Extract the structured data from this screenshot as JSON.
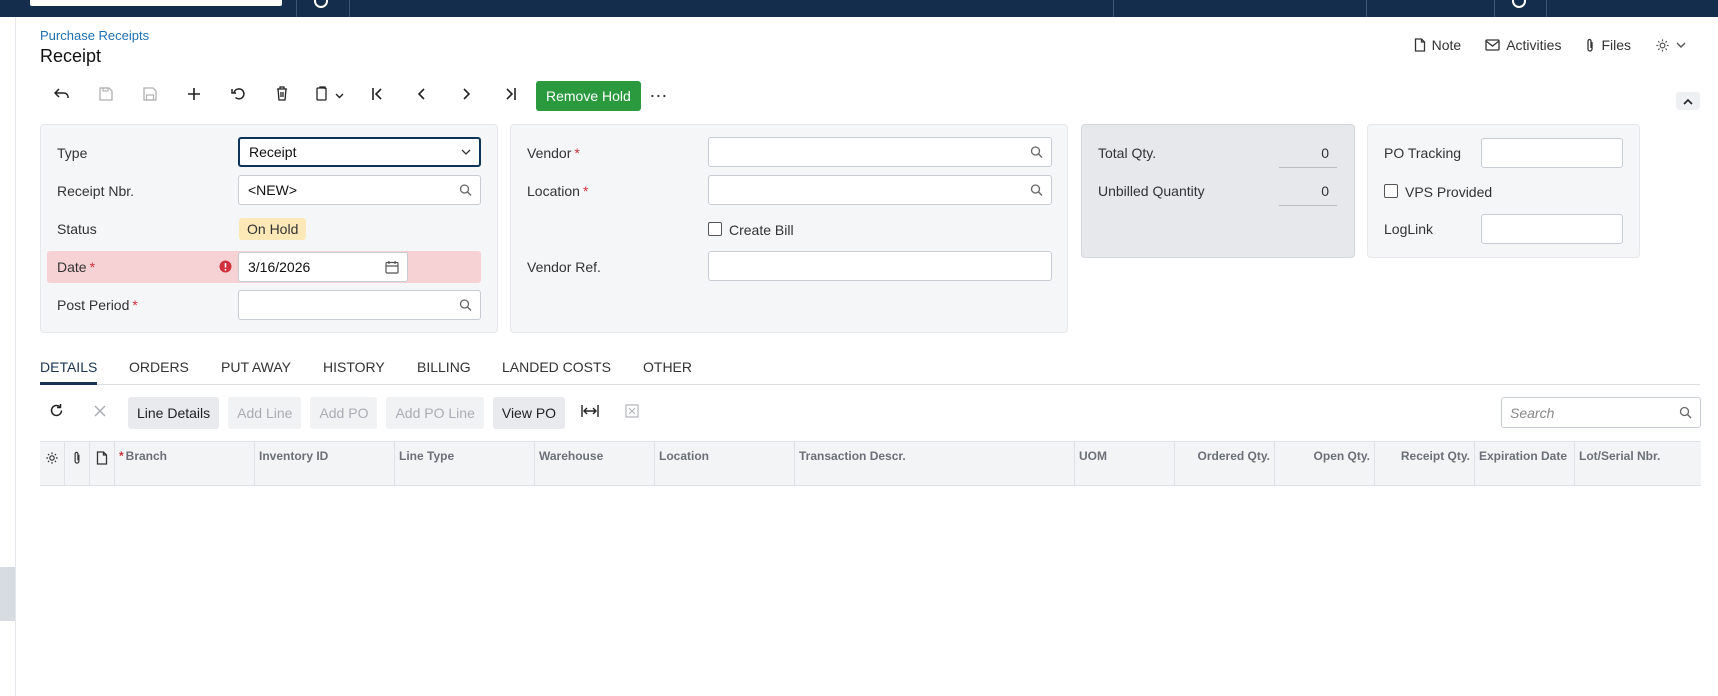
{
  "breadcrumb": "Purchase Receipts",
  "page_title": "Receipt",
  "header_actions": {
    "note": "Note",
    "activities": "Activities",
    "files": "Files"
  },
  "toolbar": {
    "remove_hold": "Remove Hold",
    "more": "⋯"
  },
  "summary": {
    "type": {
      "label": "Type",
      "value": "Receipt"
    },
    "receipt_nbr": {
      "label": "Receipt Nbr.",
      "value": "<NEW>"
    },
    "status": {
      "label": "Status",
      "value": "On Hold"
    },
    "date": {
      "label": "Date",
      "value": "3/16/2026"
    },
    "post_period": {
      "label": "Post Period",
      "value": ""
    },
    "required_mark": "*"
  },
  "vendor_panel": {
    "vendor": {
      "label": "Vendor",
      "value": ""
    },
    "location": {
      "label": "Location",
      "value": ""
    },
    "create_bill": {
      "label": "Create Bill",
      "checked": false
    },
    "vendor_ref": {
      "label": "Vendor Ref.",
      "value": ""
    }
  },
  "totals": {
    "total_qty": {
      "label": "Total Qty.",
      "value": "0"
    },
    "unbilled_qty": {
      "label": "Unbilled Quantity",
      "value": "0"
    }
  },
  "tracking": {
    "po_tracking": {
      "label": "PO Tracking",
      "value": ""
    },
    "vps_provided": {
      "label": "VPS Provided",
      "checked": false
    },
    "loglink": {
      "label": "LogLink",
      "value": ""
    }
  },
  "tabs": [
    "DETAILS",
    "ORDERS",
    "PUT AWAY",
    "HISTORY",
    "BILLING",
    "LANDED COSTS",
    "OTHER"
  ],
  "grid_toolbar": {
    "line_details": "Line Details",
    "add_line": "Add Line",
    "add_po": "Add PO",
    "add_po_line": "Add PO Line",
    "view_po": "View PO",
    "search_placeholder": "Search"
  },
  "grid_columns": [
    "Branch",
    "Inventory ID",
    "Line Type",
    "Warehouse",
    "Location",
    "Transaction Descr.",
    "UOM",
    "Ordered Qty.",
    "Open Qty.",
    "Receipt Qty.",
    "Expiration Date",
    "Lot/Serial Nbr."
  ],
  "colors": {
    "topbar": "#142d4c",
    "primary_button": "#2b9a3e",
    "link": "#1f6fb2",
    "error": "#d0313d",
    "status_badge": "#fde8b8"
  }
}
